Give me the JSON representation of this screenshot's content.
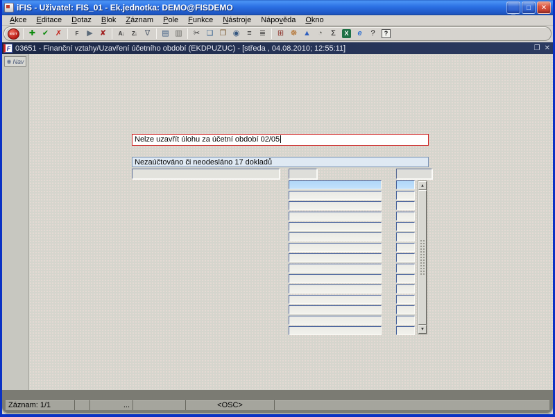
{
  "window": {
    "title": "iFIS - Uživatel: FIS_01 - Ek.jednotka: DEMO@FISDEMO",
    "controls": {
      "minimize": "_",
      "maximize": "□",
      "close": "✕"
    }
  },
  "menu": {
    "items": [
      {
        "label": "Akce",
        "u": 0
      },
      {
        "label": "Editace",
        "u": 0
      },
      {
        "label": "Dotaz",
        "u": 0
      },
      {
        "label": "Blok",
        "u": 0
      },
      {
        "label": "Záznam",
        "u": 0
      },
      {
        "label": "Pole",
        "u": 0
      },
      {
        "label": "Funkce",
        "u": 0
      },
      {
        "label": "Nástroje",
        "u": 0
      },
      {
        "label": "Nápověda",
        "u": 4
      },
      {
        "label": "Okno",
        "u": 0
      }
    ]
  },
  "toolbar": {
    "items": [
      {
        "name": "exit-button",
        "type": "exit",
        "glyph": "EXIT"
      },
      {
        "type": "sep"
      },
      {
        "name": "insert-record-icon",
        "glyph": "✚",
        "color": "#0c8a0c"
      },
      {
        "name": "update-record-icon",
        "glyph": "✔",
        "color": "#0c8a0c"
      },
      {
        "name": "delete-record-icon",
        "glyph": "✗",
        "color": "#c22018"
      },
      {
        "type": "sep"
      },
      {
        "name": "enter-query-icon",
        "glyph": "F",
        "color": "#444444",
        "small": true
      },
      {
        "name": "execute-query-icon",
        "glyph": "▶",
        "color": "#5a6a7a"
      },
      {
        "name": "cancel-query-icon",
        "glyph": "✘",
        "color": "#a02020"
      },
      {
        "type": "sep"
      },
      {
        "name": "sort-ascending-icon",
        "glyph": "A↓",
        "color": "#333333",
        "small": true
      },
      {
        "name": "sort-descending-icon",
        "glyph": "Z↓",
        "color": "#333333",
        "small": true
      },
      {
        "name": "filter-icon",
        "glyph": "∇",
        "color": "#55606f"
      },
      {
        "type": "sep"
      },
      {
        "name": "print-icon",
        "glyph": "▤",
        "color": "#33557f"
      },
      {
        "name": "print-preview-icon",
        "glyph": "▥",
        "color": "#666660"
      },
      {
        "type": "sep"
      },
      {
        "name": "cut-icon",
        "glyph": "✂",
        "color": "#333333"
      },
      {
        "name": "copy-icon",
        "glyph": "❏",
        "color": "#335f8f"
      },
      {
        "name": "paste-icon",
        "glyph": "❐",
        "color": "#7a5a30"
      },
      {
        "name": "find-document-icon",
        "glyph": "◉",
        "color": "#33557f"
      },
      {
        "name": "list-values-icon",
        "glyph": "≡",
        "color": "#333333"
      },
      {
        "name": "list-columns-icon",
        "glyph": "≣",
        "color": "#333333"
      },
      {
        "type": "sep"
      },
      {
        "name": "calendar-icon",
        "glyph": "⊞",
        "color": "#8a3028"
      },
      {
        "name": "navigator-helm-icon",
        "glyph": "☸",
        "color": "#b06820"
      },
      {
        "name": "image-icon",
        "glyph": "▲",
        "color": "#2f5fbf"
      },
      {
        "name": "time-icon",
        "glyph": "◔",
        "color": "#555550"
      },
      {
        "name": "sum-icon",
        "glyph": "Σ",
        "color": "#111111"
      },
      {
        "name": "excel-icon",
        "glyph": "X",
        "color": "#ffffff",
        "bg": "#1e7145"
      },
      {
        "name": "web-icon",
        "glyph": "e",
        "color": "#2f6fd0",
        "italic": true
      },
      {
        "name": "help-topics-icon",
        "glyph": "?",
        "color": "#111111"
      },
      {
        "name": "context-help-icon",
        "glyph": "?",
        "color": "#111111",
        "boxed": true
      }
    ]
  },
  "mdi": {
    "title": "03651 - Finanční vztahy/Uzavření účetního období (EKDPUZUC) - [středa , 04.08.2010; 12:55:11]",
    "icon_letter": "F",
    "restore": "❐",
    "close": "✕"
  },
  "nav": {
    "label": "Nav",
    "dot": "◉"
  },
  "form": {
    "error_message": "Nelze uzavřít úlohu za účetní období 02/05",
    "info_message": "Nezaúčtováno či neodesláno 17 dokladů",
    "list": {
      "visible_rows": 15,
      "selected_row": 1
    },
    "scrollbar": {
      "up": "▲",
      "down": "▼"
    }
  },
  "status_bar": {
    "segments": [
      {
        "text": "Záznam: 1/1",
        "w": 100
      },
      {
        "text": "",
        "w": 22
      },
      {
        "text": "...",
        "w": 62,
        "align": "right"
      },
      {
        "text": "",
        "w": 76
      },
      {
        "text": "<OSC>",
        "w": 128,
        "align": "center"
      },
      {
        "text": "",
        "grow": true
      }
    ]
  },
  "colors": {
    "error_border": "#cf1f1f",
    "selection": "#b3d7f8",
    "mdi_titlebar": "#1f2c4e",
    "xp_border": "#0a31c4"
  }
}
